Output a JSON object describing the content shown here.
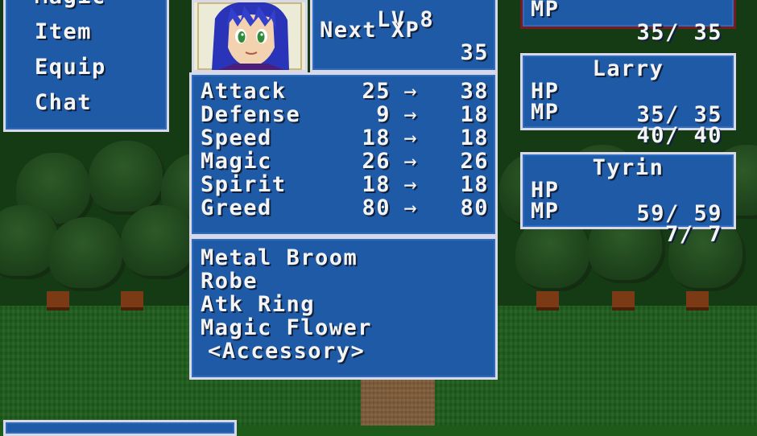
{
  "menu": {
    "items": [
      "Magic",
      "Item",
      "Equip",
      "Chat"
    ]
  },
  "hero": {
    "level_label": "LV",
    "level": "8",
    "next_xp_label": "Next XP",
    "next_xp": "35"
  },
  "stats": [
    {
      "label": "Attack",
      "current": "25",
      "new": "38"
    },
    {
      "label": "Defense",
      "current": "9",
      "new": "18"
    },
    {
      "label": "Speed",
      "current": "18",
      "new": "18"
    },
    {
      "label": "Magic",
      "current": "26",
      "new": "26"
    },
    {
      "label": "Spirit",
      "current": "18",
      "new": "18"
    },
    {
      "label": "Greed",
      "current": "80",
      "new": "80"
    }
  ],
  "equipment": [
    "Metal Broom",
    "Robe",
    "Atk Ring",
    "Magic Flower",
    "<Accessory>"
  ],
  "party": {
    "top": {
      "mp_label": "MP",
      "mp": "35",
      "mp_max": "35"
    },
    "members": [
      {
        "name": "Larry",
        "hp": "35",
        "hp_max": "35",
        "mp": "40",
        "mp_max": "40"
      },
      {
        "name": "Tyrin",
        "hp": "59",
        "hp_max": "59",
        "mp": "7",
        "mp_max": "7"
      }
    ],
    "hp_label": "HP",
    "mp_label": "MP"
  },
  "colors": {
    "window": "#1f5aa6",
    "border": "#d8d8e8",
    "text": "#f4f4f4",
    "grass": "#1f5d1c",
    "forest": "#153b14"
  }
}
